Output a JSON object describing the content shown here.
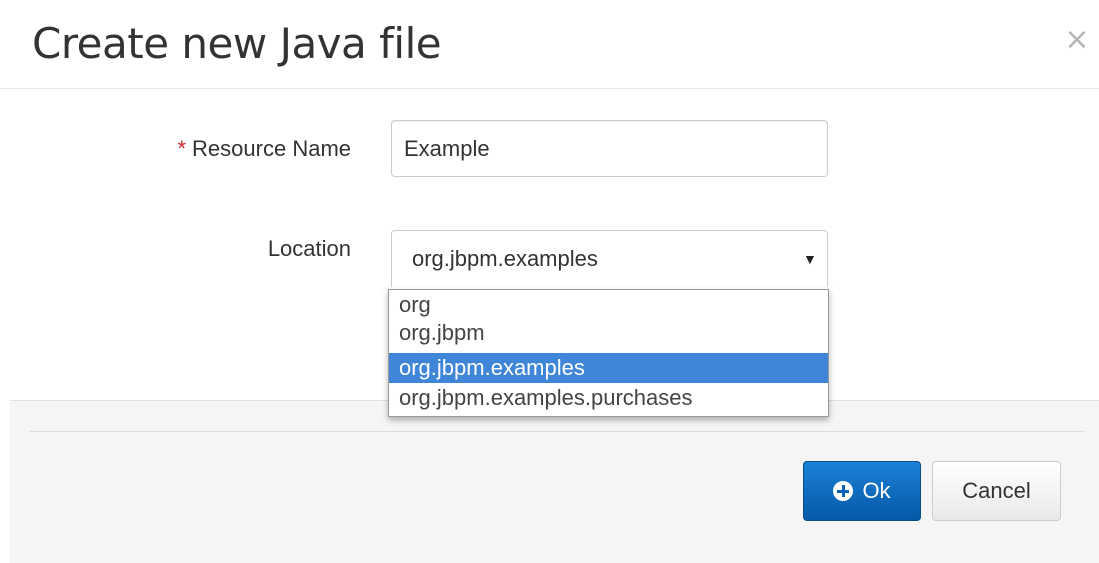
{
  "dialog": {
    "title": "Create new Java file",
    "close_glyph": "×"
  },
  "form": {
    "resource_name": {
      "required_marker": "*",
      "label": "Resource Name",
      "value": "Example"
    },
    "location": {
      "label": "Location",
      "selected": "org.jbpm.examples",
      "arrow_glyph": "▼",
      "options": [
        "org",
        "org.jbpm",
        "org.jbpm.examples",
        "org.jbpm.examples.purchases"
      ]
    }
  },
  "footer": {
    "ok_label": "Ok",
    "cancel_label": "Cancel"
  },
  "colors": {
    "primary": "#0a6bc4",
    "highlight": "#3f86d8",
    "required": "#d9232d"
  },
  "icons": {
    "ok": "plus-circle-icon",
    "close": "close-icon",
    "dropdown": "caret-down-icon"
  }
}
